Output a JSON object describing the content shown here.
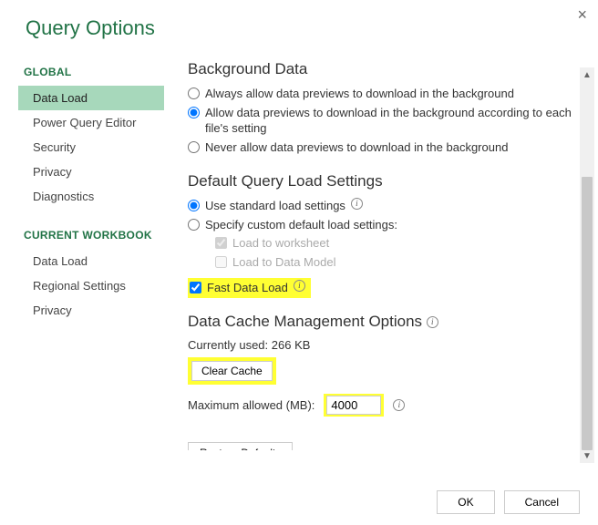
{
  "dialog": {
    "title": "Query Options"
  },
  "sidebar": {
    "global_label": "GLOBAL",
    "current_wb_label": "CURRENT WORKBOOK",
    "global_items": [
      {
        "label": "Data Load"
      },
      {
        "label": "Power Query Editor"
      },
      {
        "label": "Security"
      },
      {
        "label": "Privacy"
      },
      {
        "label": "Diagnostics"
      }
    ],
    "wb_items": [
      {
        "label": "Data Load"
      },
      {
        "label": "Regional Settings"
      },
      {
        "label": "Privacy"
      }
    ]
  },
  "main": {
    "bg_heading": "Background Data",
    "bg_opt_always": "Always allow data previews to download in the background",
    "bg_opt_each": "Allow data previews to download in the background according to each file's setting",
    "bg_opt_never": "Never allow data previews to download in the background",
    "dql_heading": "Default Query Load Settings",
    "use_std": "Use standard load settings",
    "specify_custom": "Specify custom default load settings:",
    "load_ws": "Load to worksheet",
    "load_dm": "Load to Data Model",
    "fast_load": "Fast Data Load",
    "cache_heading": "Data Cache Management Options",
    "currently_used": "Currently used: 266 KB",
    "clear_cache": "Clear Cache",
    "max_allowed_label": "Maximum allowed (MB):",
    "max_allowed_value": "4000",
    "restore_defaults": "Restore Defaults"
  },
  "footer": {
    "ok": "OK",
    "cancel": "Cancel"
  }
}
